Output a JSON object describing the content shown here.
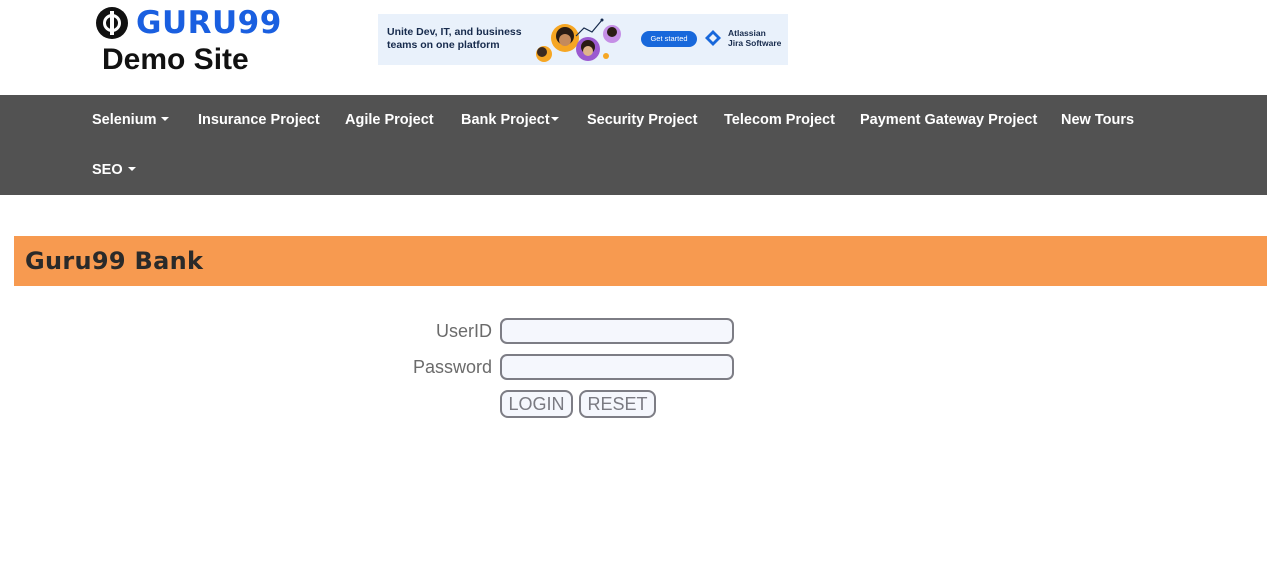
{
  "header": {
    "logo_text": "GURU99",
    "site_title": "Demo Site"
  },
  "ad": {
    "headline": "Unite Dev, IT, and business teams on one platform",
    "cta_label": "Get started",
    "brand_line1": "Atlassian",
    "brand_line2": "Jira Software",
    "brand_color": "#1868db"
  },
  "nav": {
    "background": "#525252",
    "items": [
      {
        "label": "Selenium",
        "dropdown": true
      },
      {
        "label": "Insurance Project",
        "dropdown": false
      },
      {
        "label": "Agile Project",
        "dropdown": false
      },
      {
        "label": "Bank Project",
        "dropdown": true
      },
      {
        "label": "Security Project",
        "dropdown": false
      },
      {
        "label": "Telecom Project",
        "dropdown": false
      },
      {
        "label": "Payment Gateway Project",
        "dropdown": false
      },
      {
        "label": "New Tours",
        "dropdown": false
      },
      {
        "label": "SEO",
        "dropdown": true
      }
    ]
  },
  "page": {
    "heading": "Guru99 Bank",
    "heading_background": "#f79a50"
  },
  "login_form": {
    "userid_label": "UserID",
    "userid_value": "",
    "password_label": "Password",
    "password_value": "",
    "login_button": "LOGIN",
    "reset_button": "RESET"
  }
}
